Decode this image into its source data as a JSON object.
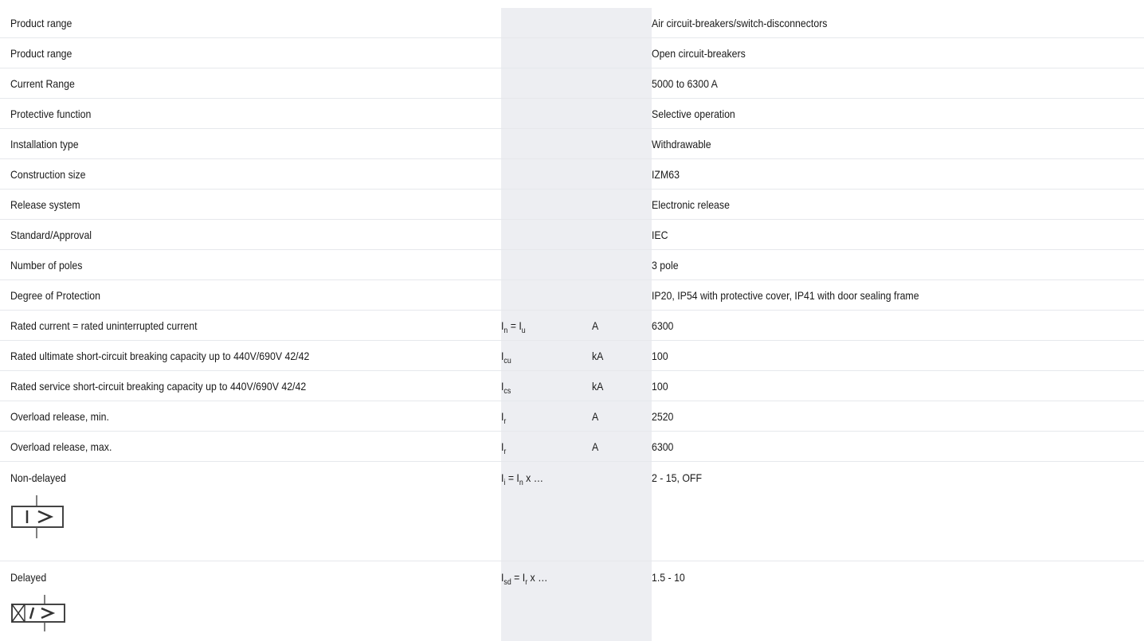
{
  "rows": [
    {
      "label": "Product range",
      "value": "Air circuit-breakers/switch-disconnectors"
    },
    {
      "label": "Product range",
      "value": "Open circuit-breakers"
    },
    {
      "label": "Current Range",
      "value": "5000 to 6300 A"
    },
    {
      "label": "Protective function",
      "value": "Selective operation"
    },
    {
      "label": "Installation type",
      "value": "Withdrawable"
    },
    {
      "label": "Construction size",
      "value": "IZM63"
    },
    {
      "label": "Release system",
      "value": "Electronic release"
    },
    {
      "label": "Standard/Approval",
      "value": "IEC"
    },
    {
      "label": "Number of poles",
      "value": "3 pole"
    },
    {
      "label": "Degree of Protection",
      "value": "IP20, IP54 with protective cover, IP41 with door sealing frame"
    },
    {
      "label": "Rated current = rated uninterrupted current",
      "sym_a": "I",
      "sym_a_sub": "n",
      "sym_b": " = I",
      "sym_b_sub": "u",
      "unit": "A",
      "value": "6300"
    },
    {
      "label": "Rated ultimate short-circuit breaking capacity up to 440V/690V 42/42",
      "sym_a": "I",
      "sym_a_sub": "cu",
      "unit": "kA",
      "value": "100"
    },
    {
      "label": "Rated service short-circuit breaking capacity up to 440V/690V 42/42",
      "sym_a": "I",
      "sym_a_sub": "cs",
      "unit": "kA",
      "value": "100"
    },
    {
      "label": "Overload release, min.",
      "sym_a": "I",
      "sym_a_sub": "r",
      "unit": "A",
      "value": "2520"
    },
    {
      "label": "Overload release, max.",
      "sym_a": "I",
      "sym_a_sub": "r",
      "unit": "A",
      "value": "6300"
    },
    {
      "label": "Non-delayed",
      "sym_a": "I",
      "sym_a_sub": "i",
      "sym_b": " = I",
      "sym_b_sub": "n",
      "sym_c": " x …",
      "value": "2 - 15, OFF",
      "icon": "non-delayed-release-symbol-icon"
    },
    {
      "label": "Delayed",
      "sym_a": "I",
      "sym_a_sub": "sd",
      "sym_b": " = I",
      "sym_b_sub": "r",
      "sym_c": " x …",
      "value": "1.5 - 10",
      "icon": "delayed-release-symbol-icon"
    }
  ],
  "colors": {
    "heading_blue": "#0a6fb8",
    "symbol_column_bg": "#edeef2",
    "row_divider": "#e6e8ec"
  }
}
